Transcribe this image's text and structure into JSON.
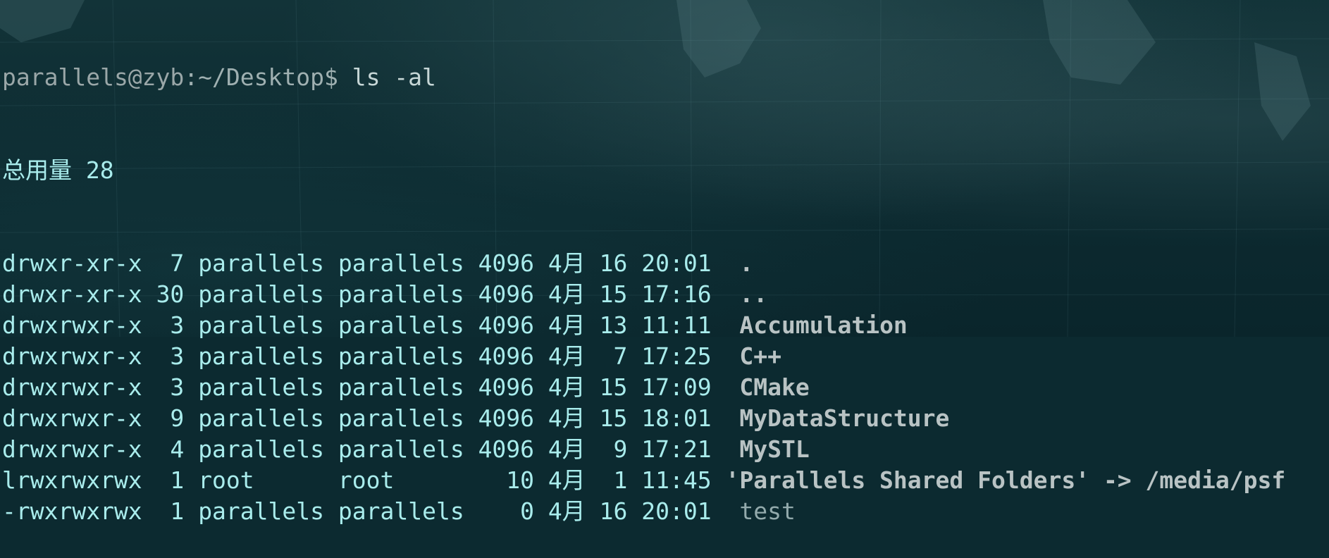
{
  "terminal": {
    "prompt": {
      "user_host": "parallels@zyb",
      "path": ":~/Desktop$ ",
      "command": "ls -al"
    },
    "total_line": "总用量 28",
    "entries": [
      {
        "perms": "drwxr-xr-x",
        "links": " 7",
        "owner": "parallels",
        "group": "parallels",
        "size": "4096",
        "month": "4月",
        "day": "16",
        "time": "20:01",
        "name": ".",
        "kind": "dir"
      },
      {
        "perms": "drwxr-xr-x",
        "links": "30",
        "owner": "parallels",
        "group": "parallels",
        "size": "4096",
        "month": "4月",
        "day": "15",
        "time": "17:16",
        "name": "..",
        "kind": "dir"
      },
      {
        "perms": "drwxrwxr-x",
        "links": " 3",
        "owner": "parallels",
        "group": "parallels",
        "size": "4096",
        "month": "4月",
        "day": "13",
        "time": "11:11",
        "name": "Accumulation",
        "kind": "dir"
      },
      {
        "perms": "drwxrwxr-x",
        "links": " 3",
        "owner": "parallels",
        "group": "parallels",
        "size": "4096",
        "month": "4月",
        "day": " 7",
        "time": "17:25",
        "name": "C++",
        "kind": "dir"
      },
      {
        "perms": "drwxrwxr-x",
        "links": " 3",
        "owner": "parallels",
        "group": "parallels",
        "size": "4096",
        "month": "4月",
        "day": "15",
        "time": "17:09",
        "name": "CMake",
        "kind": "dir"
      },
      {
        "perms": "drwxrwxr-x",
        "links": " 9",
        "owner": "parallels",
        "group": "parallels",
        "size": "4096",
        "month": "4月",
        "day": "15",
        "time": "18:01",
        "name": "MyDataStructure",
        "kind": "dir"
      },
      {
        "perms": "drwxrwxr-x",
        "links": " 4",
        "owner": "parallels",
        "group": "parallels",
        "size": "4096",
        "month": "4月",
        "day": " 9",
        "time": "17:21",
        "name": "MySTL",
        "kind": "dir"
      },
      {
        "perms": "lrwxrwxrwx",
        "links": " 1",
        "owner": "root     ",
        "group": "root     ",
        "size": "  10",
        "month": "4月",
        "day": " 1",
        "time": "11:45",
        "name": "'Parallels Shared Folders' -> /media/psf",
        "kind": "link"
      },
      {
        "perms": "-rwxrwxrwx",
        "links": " 1",
        "owner": "parallels",
        "group": "parallels",
        "size": "   0",
        "month": "4月",
        "day": "16",
        "time": "20:01",
        "name": "test",
        "kind": "file"
      }
    ]
  },
  "colors": {
    "text": "#a9ecec",
    "dir_name": "#b9c3c4",
    "file_name": "#93aaac",
    "background": "#0c2a30"
  }
}
